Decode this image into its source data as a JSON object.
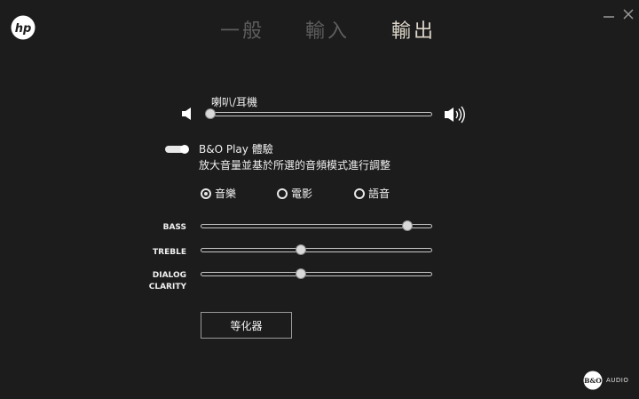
{
  "tabs": [
    {
      "label": "一般",
      "active": false
    },
    {
      "label": "輸入",
      "active": false
    },
    {
      "label": "輸出",
      "active": true
    }
  ],
  "output": {
    "device_label": "喇叭/耳機",
    "volume_level": 0.0,
    "bo_toggle_on": true,
    "bo_title": "B&O Play 體驗",
    "bo_description": "放大音量並基於所選的音頻模式進行調整",
    "modes": [
      {
        "label": "音樂",
        "selected": true
      },
      {
        "label": "電影",
        "selected": false
      },
      {
        "label": "語音",
        "selected": false
      }
    ],
    "tone": {
      "bass_label": "BASS",
      "bass_level": 0.91,
      "treble_label": "TREBLE",
      "treble_level": 0.43,
      "dialog_label_line1": "DIALOG",
      "dialog_label_line2": "CLARITY",
      "dialog_level": 0.43
    },
    "equalizer_button": "等化器"
  },
  "brand": {
    "hp_logo_text": "hp",
    "bo_logo_text": "B&O",
    "bo_audio_text": "AUDIO"
  },
  "colors": {
    "background": "#1c1c1c",
    "tab_active": "#ddd6c8",
    "tab_inactive": "#5d5d5d"
  },
  "icons": [
    "hp-logo",
    "minimize-icon",
    "close-icon",
    "speaker-mute-icon",
    "speaker-loud-icon",
    "bo-logo"
  ]
}
